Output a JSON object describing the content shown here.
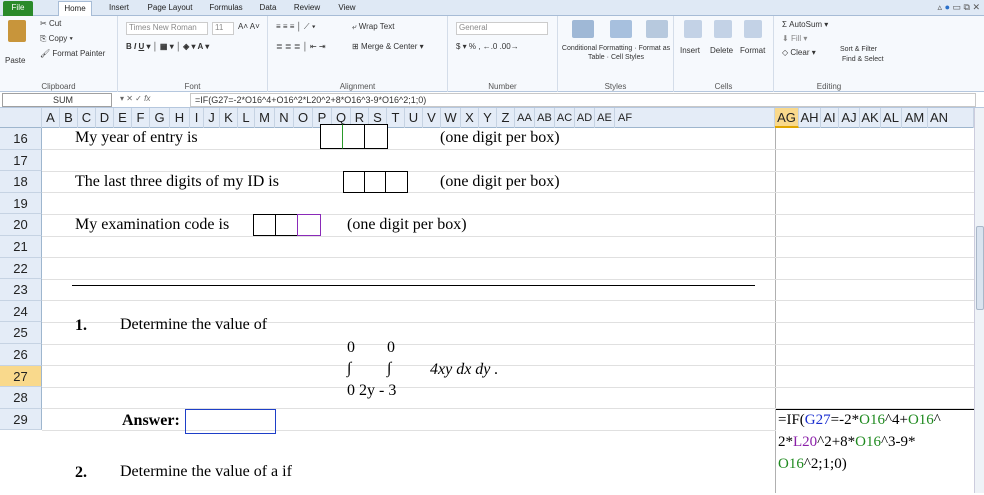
{
  "tabs": [
    "File",
    "Home",
    "Insert",
    "Page Layout",
    "Formulas",
    "Data",
    "Review",
    "View"
  ],
  "clipboard": {
    "paste": "Paste",
    "cut": "Cut",
    "copy": "Copy",
    "format_painter": "Format Painter",
    "label": "Clipboard"
  },
  "font": {
    "name": "Times New Roman",
    "size": "11",
    "label": "Font"
  },
  "alignment": {
    "wrap": "Wrap Text",
    "merge": "Merge & Center",
    "label": "Alignment"
  },
  "number": {
    "format": "General",
    "label": "Number"
  },
  "styles": {
    "conditional": "Conditional Formatting",
    "format_table": "Format as Table",
    "cell_styles": "Cell Styles",
    "label": "Styles"
  },
  "cells": {
    "insert": "Insert",
    "delete": "Delete",
    "format": "Format",
    "label": "Cells"
  },
  "editing": {
    "autosum": "AutoSum",
    "fill": "Fill",
    "clear": "Clear",
    "sort": "Sort & Filter",
    "find": "Find & Select",
    "label": "Editing"
  },
  "name_box": "SUM",
  "formula": "=IF(G27=-2*O16^4+O16^2*L20^2+8*O16^3-9*O16^2;1;0)",
  "columns": [
    "A",
    "B",
    "C",
    "D",
    "E",
    "F",
    "G",
    "H",
    "I",
    "J",
    "K",
    "L",
    "M",
    "N",
    "O",
    "P",
    "Q",
    "R",
    "S",
    "T",
    "U",
    "V",
    "W",
    "X",
    "Y",
    "Z",
    "AA",
    "AB",
    "AC",
    "AD",
    "AE",
    "AF",
    "AG",
    "AH",
    "AI",
    "AJ",
    "AK",
    "AL",
    "AM",
    "AN"
  ],
  "rows": [
    "16",
    "17",
    "18",
    "19",
    "20",
    "21",
    "22",
    "23",
    "24",
    "25",
    "26",
    "27",
    "28",
    "29"
  ],
  "cells_text": {
    "r16": "My year of entry is",
    "r16b": "(one digit per box)",
    "r18": "The last three digits of my ID is",
    "r18b": "(one digit per box)",
    "r20": "My examination code is",
    "r20b": "(one digit per box)",
    "q1": "1.",
    "q1t": "Determine the value of",
    "l0a": "0",
    "l0b": "0",
    "int1": "∫",
    "int2": "∫",
    "integrand": "4xy  dx dy .",
    "l3": "0  2y - 3",
    "answer": "Answer:",
    "q2": "2.",
    "q2t": "Determine the value of a  if"
  },
  "formula_cell": {
    "l1a": "=IF(",
    "l1b": "G27",
    "l1c": "=-2*",
    "l1d": "O16",
    "l1e": "^4+",
    "l1f": "O16",
    "l1g": "^",
    "l2a": "2*",
    "l2b": "L20",
    "l2c": "^2+8*",
    "l2d": "O16",
    "l2e": "^3-9*",
    "l3a": "O16",
    "l3b": "^2;1;0)"
  }
}
